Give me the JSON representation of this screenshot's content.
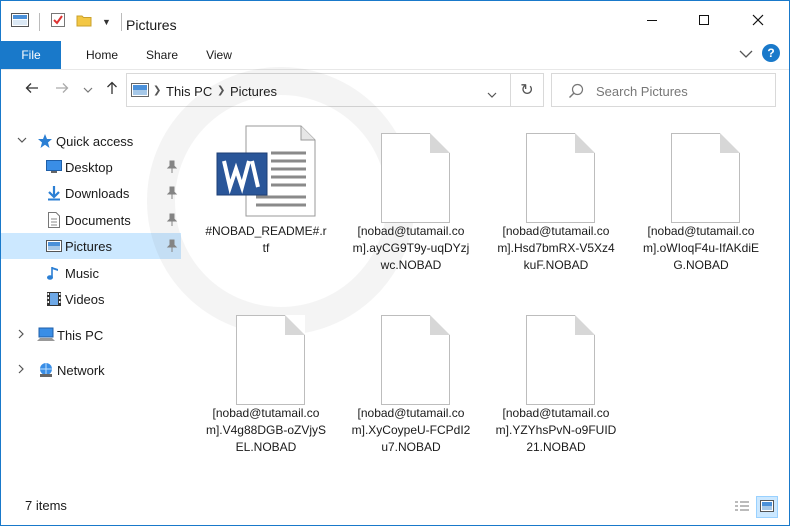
{
  "window": {
    "title": "Pictures"
  },
  "ribbon": {
    "tabs": [
      {
        "label": "File"
      },
      {
        "label": "Home"
      },
      {
        "label": "Share"
      },
      {
        "label": "View"
      }
    ],
    "help_label": "?"
  },
  "address": {
    "crumbs": [
      "This PC",
      "Pictures"
    ]
  },
  "search": {
    "placeholder": "Search Pictures"
  },
  "nav": {
    "quick_access": "Quick access",
    "items": [
      {
        "label": "Desktop",
        "icon": "desktop-icon",
        "pinned": true
      },
      {
        "label": "Downloads",
        "icon": "downloads-icon",
        "pinned": true
      },
      {
        "label": "Documents",
        "icon": "documents-icon",
        "pinned": true
      },
      {
        "label": "Pictures",
        "icon": "pictures-icon",
        "pinned": true,
        "selected": true
      },
      {
        "label": "Music",
        "icon": "music-icon",
        "pinned": false
      },
      {
        "label": "Videos",
        "icon": "videos-icon",
        "pinned": false
      }
    ],
    "this_pc": "This PC",
    "network": "Network"
  },
  "files": [
    {
      "name": "#NOBAD_README#.rtf",
      "icon": "word-document-icon"
    },
    {
      "name": "[nobad@tutamail.com].ayCG9T9y-uqDYzjwc.NOBAD",
      "icon": "blank-file-icon"
    },
    {
      "name": "[nobad@tutamail.com].Hsd7bmRX-V5Xz4kuF.NOBAD",
      "icon": "blank-file-icon"
    },
    {
      "name": "[nobad@tutamail.com].oWIoqF4u-IfAKdiEG.NOBAD",
      "icon": "blank-file-icon"
    },
    {
      "name": "[nobad@tutamail.com].V4g88DGB-oZVjySEL.NOBAD",
      "icon": "blank-file-icon"
    },
    {
      "name": "[nobad@tutamail.com].XyCoypeU-FCPdI2u7.NOBAD",
      "icon": "blank-file-icon"
    },
    {
      "name": "[nobad@tutamail.com].YZYhsPvN-o9FUID21.NOBAD",
      "icon": "blank-file-icon"
    }
  ],
  "status": {
    "item_count": "7 items"
  },
  "colors": {
    "accent": "#1979ca",
    "selection": "#cce8ff"
  }
}
